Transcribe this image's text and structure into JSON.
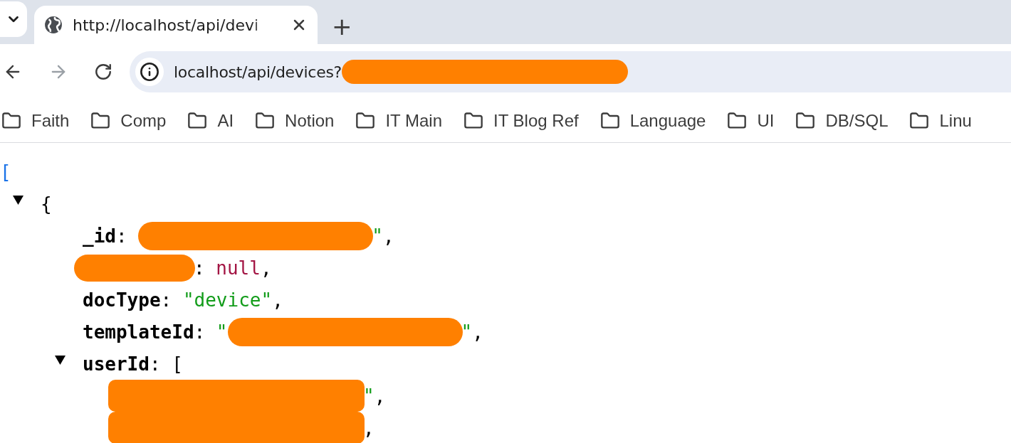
{
  "tab_strip": {
    "tabs": [
      {
        "title": "http://localhost/api/devi",
        "selected": true
      }
    ],
    "new_tab": "+"
  },
  "toolbar": {
    "back": {
      "disabled": false
    },
    "forward": {
      "disabled": true
    },
    "address": {
      "value": "localhost/api/devices?",
      "redacted": true
    }
  },
  "bookmarks": [
    {
      "label": "Faith"
    },
    {
      "label": "Comp"
    },
    {
      "label": "AI"
    },
    {
      "label": "Notion"
    },
    {
      "label": "IT Main"
    },
    {
      "label": "IT Blog Ref"
    },
    {
      "label": "Language"
    },
    {
      "label": "UI"
    },
    {
      "label": "DB/SQL"
    },
    {
      "label": "Linu"
    }
  ],
  "json_view": {
    "lines": [
      {
        "tokens": [
          {
            "kind": "bracket",
            "text": "["
          }
        ],
        "children": [
          {
            "toggle": {
              "expanded": true
            },
            "tokens": [
              {
                "kind": "punct",
                "text": "{"
              }
            ],
            "children": [
              {
                "tokens": [
                  {
                    "kind": "key",
                    "text": "_id"
                  },
                  {
                    "kind": "colon",
                    "text": ":"
                  },
                  {
                    "kind": "redactedvalue"
                  },
                  {
                    "kind": "string",
                    "text": "\""
                  },
                  {
                    "kind": "punct",
                    "text": ","
                  }
                ]
              },
              {
                "tokens": [
                  {
                    "kind": "redactedkey"
                  },
                  {
                    "kind": "colon",
                    "text": ":"
                  },
                  {
                    "kind": "null",
                    "text": "null"
                  },
                  {
                    "kind": "punct",
                    "text": ","
                  }
                ]
              },
              {
                "tokens": [
                  {
                    "kind": "key",
                    "text": "docType"
                  },
                  {
                    "kind": "colon",
                    "text": ":"
                  },
                  {
                    "kind": "string",
                    "text": "\"device\""
                  },
                  {
                    "kind": "punct",
                    "text": ","
                  }
                ]
              },
              {
                "tokens": [
                  {
                    "kind": "key",
                    "text": "templateId"
                  },
                  {
                    "kind": "colon",
                    "text": ":"
                  },
                  {
                    "kind": "string",
                    "text": "\""
                  },
                  {
                    "kind": "redactedvalue"
                  },
                  {
                    "kind": "string",
                    "text": "\""
                  },
                  {
                    "kind": "punct",
                    "text": ","
                  }
                ]
              },
              {
                "toggle": {
                  "expanded": true
                },
                "tokens": [
                  {
                    "kind": "key",
                    "text": "userId"
                  },
                  {
                    "kind": "colon",
                    "text": ":"
                  },
                  {
                    "kind": "punct",
                    "text": "["
                  }
                ],
                "children": [
                  {
                    "tokens": [
                      {
                        "kind": "redacteditem"
                      },
                      {
                        "kind": "string",
                        "text": "\""
                      },
                      {
                        "kind": "punct",
                        "text": ","
                      }
                    ]
                  },
                  {
                    "tokens": [
                      {
                        "kind": "redacteditem"
                      },
                      {
                        "kind": "punct",
                        "text": ","
                      }
                    ]
                  }
                ]
              }
            ]
          }
        ]
      }
    ]
  }
}
